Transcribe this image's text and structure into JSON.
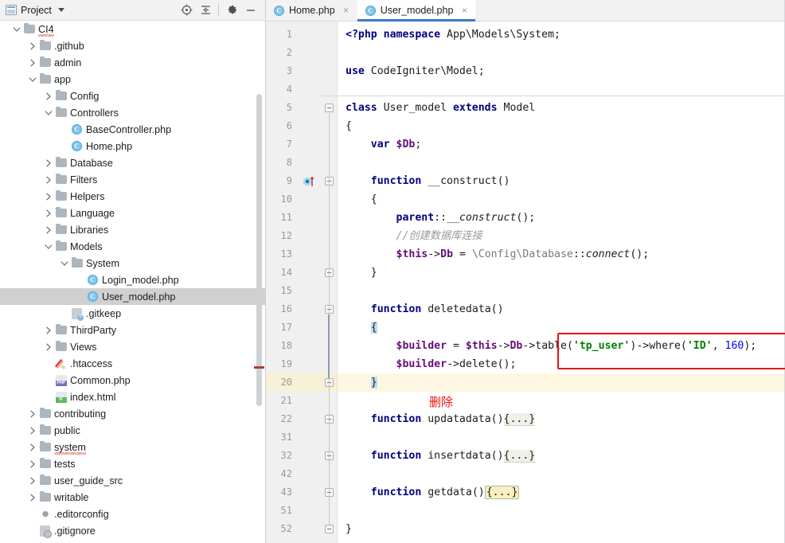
{
  "project_panel": {
    "title": "Project",
    "icon": "project-icon",
    "dropdown_caret": "chevron-down-icon",
    "toolbar_buttons": [
      {
        "name": "select-opened-file-icon",
        "label": ""
      },
      {
        "name": "collapse-all-icon",
        "label": ""
      },
      {
        "name": "settings-gear-icon",
        "label": ""
      },
      {
        "name": "hide-panel-minimize-icon",
        "label": ""
      }
    ],
    "tree": [
      {
        "label": "CI4",
        "depth": 0,
        "icon": "folder",
        "state": "expanded",
        "selected": false,
        "squiggle": true
      },
      {
        "label": ".github",
        "depth": 1,
        "icon": "folder",
        "state": "collapsed",
        "selected": false,
        "squiggle": false
      },
      {
        "label": "admin",
        "depth": 1,
        "icon": "folder",
        "state": "collapsed",
        "selected": false,
        "squiggle": false
      },
      {
        "label": "app",
        "depth": 1,
        "icon": "folder",
        "state": "expanded",
        "selected": false,
        "squiggle": false
      },
      {
        "label": "Config",
        "depth": 2,
        "icon": "folder",
        "state": "collapsed",
        "selected": false,
        "squiggle": false
      },
      {
        "label": "Controllers",
        "depth": 2,
        "icon": "folder",
        "state": "expanded",
        "selected": false,
        "squiggle": false
      },
      {
        "label": "BaseController.php",
        "depth": 3,
        "icon": "class",
        "state": "leaf",
        "selected": false,
        "squiggle": false
      },
      {
        "label": "Home.php",
        "depth": 3,
        "icon": "class",
        "state": "leaf",
        "selected": false,
        "squiggle": false
      },
      {
        "label": "Database",
        "depth": 2,
        "icon": "folder",
        "state": "collapsed",
        "selected": false,
        "squiggle": false
      },
      {
        "label": "Filters",
        "depth": 2,
        "icon": "folder",
        "state": "collapsed",
        "selected": false,
        "squiggle": false
      },
      {
        "label": "Helpers",
        "depth": 2,
        "icon": "folder",
        "state": "collapsed",
        "selected": false,
        "squiggle": false
      },
      {
        "label": "Language",
        "depth": 2,
        "icon": "folder",
        "state": "collapsed",
        "selected": false,
        "squiggle": false
      },
      {
        "label": "Libraries",
        "depth": 2,
        "icon": "folder",
        "state": "collapsed",
        "selected": false,
        "squiggle": false
      },
      {
        "label": "Models",
        "depth": 2,
        "icon": "folder",
        "state": "expanded",
        "selected": false,
        "squiggle": false
      },
      {
        "label": "System",
        "depth": 3,
        "icon": "folder",
        "state": "expanded",
        "selected": false,
        "squiggle": false
      },
      {
        "label": "Login_model.php",
        "depth": 4,
        "icon": "class",
        "state": "leaf",
        "selected": false,
        "squiggle": false
      },
      {
        "label": "User_model.php",
        "depth": 4,
        "icon": "class",
        "state": "leaf",
        "selected": true,
        "squiggle": false
      },
      {
        "label": ".gitkeep",
        "depth": 3,
        "icon": "git",
        "state": "leaf",
        "selected": false,
        "squiggle": false
      },
      {
        "label": "ThirdParty",
        "depth": 2,
        "icon": "folder",
        "state": "collapsed",
        "selected": false,
        "squiggle": false
      },
      {
        "label": "Views",
        "depth": 2,
        "icon": "folder",
        "state": "collapsed",
        "selected": false,
        "squiggle": false
      },
      {
        "label": ".htaccess",
        "depth": 2,
        "icon": "pencil",
        "state": "leaf",
        "selected": false,
        "squiggle": false
      },
      {
        "label": "Common.php",
        "depth": 2,
        "icon": "php",
        "state": "leaf",
        "selected": false,
        "squiggle": false
      },
      {
        "label": "index.html",
        "depth": 2,
        "icon": "html",
        "state": "leaf",
        "selected": false,
        "squiggle": false
      },
      {
        "label": "contributing",
        "depth": 1,
        "icon": "folder",
        "state": "collapsed",
        "selected": false,
        "squiggle": false
      },
      {
        "label": "public",
        "depth": 1,
        "icon": "folder",
        "state": "collapsed",
        "selected": false,
        "squiggle": false
      },
      {
        "label": "system",
        "depth": 1,
        "icon": "folder",
        "state": "collapsed",
        "selected": false,
        "squiggle": true
      },
      {
        "label": "tests",
        "depth": 1,
        "icon": "folder",
        "state": "collapsed",
        "selected": false,
        "squiggle": false
      },
      {
        "label": "user_guide_src",
        "depth": 1,
        "icon": "folder",
        "state": "collapsed",
        "selected": false,
        "squiggle": false
      },
      {
        "label": "writable",
        "depth": 1,
        "icon": "folder",
        "state": "collapsed",
        "selected": false,
        "squiggle": false
      },
      {
        "label": ".editorconfig",
        "depth": 1,
        "icon": "gear",
        "state": "leaf",
        "selected": false,
        "squiggle": false
      },
      {
        "label": ".gitignore",
        "depth": 1,
        "icon": "gitign",
        "state": "leaf",
        "selected": false,
        "squiggle": false
      }
    ]
  },
  "editor": {
    "tabs": [
      {
        "label": "Home.php",
        "icon": "php-class-icon",
        "active": false,
        "close": "×"
      },
      {
        "label": "User_model.php",
        "icon": "php-class-icon",
        "active": true,
        "close": "×"
      }
    ],
    "line_numbers": [
      "1",
      "2",
      "3",
      "4",
      "5",
      "6",
      "7",
      "8",
      "9",
      "10",
      "11",
      "12",
      "13",
      "14",
      "15",
      "16",
      "17",
      "18",
      "19",
      "20",
      "21",
      "22",
      "31",
      "32",
      "42",
      "43",
      "51",
      "52"
    ],
    "current_line": "20",
    "lines": [
      {
        "n": "1",
        "text": "<?php namespace App\\Models\\System;"
      },
      {
        "n": "2",
        "text": ""
      },
      {
        "n": "3",
        "text": "use CodeIgniter\\Model;"
      },
      {
        "n": "4",
        "text": ""
      },
      {
        "n": "5",
        "text": "class User_model extends Model"
      },
      {
        "n": "6",
        "text": "{"
      },
      {
        "n": "7",
        "text": "    var $Db;"
      },
      {
        "n": "8",
        "text": ""
      },
      {
        "n": "9",
        "text": "    function __construct()"
      },
      {
        "n": "10",
        "text": "    {"
      },
      {
        "n": "11",
        "text": "        parent::__construct();"
      },
      {
        "n": "12",
        "text": "        //创建数据库连接"
      },
      {
        "n": "13",
        "text": "        $this->Db = \\Config\\Database::connect();"
      },
      {
        "n": "14",
        "text": "    }"
      },
      {
        "n": "15",
        "text": ""
      },
      {
        "n": "16",
        "text": "    function deletedata()"
      },
      {
        "n": "17",
        "text": "    {"
      },
      {
        "n": "18",
        "text": "        $builder = $this->Db->table('tp_user')->where('ID', 160);"
      },
      {
        "n": "19",
        "text": "        $builder->delete();"
      },
      {
        "n": "20",
        "text": "    }"
      },
      {
        "n": "21",
        "text": ""
      },
      {
        "n": "22",
        "text": "    function updatadata(){...}"
      },
      {
        "n": "31",
        "text": ""
      },
      {
        "n": "32",
        "text": "    function insertdata(){...}"
      },
      {
        "n": "42",
        "text": ""
      },
      {
        "n": "43",
        "text": "    function getdata(){...}"
      },
      {
        "n": "51",
        "text": ""
      },
      {
        "n": "52",
        "text": "}"
      }
    ]
  },
  "annotation": {
    "label": "删除",
    "color": "#e8120f",
    "box_color": "#e8120f"
  },
  "colors": {
    "keyword": "#000080",
    "variable": "#660e7a",
    "string": "#008000",
    "number": "#0000ff",
    "comment": "#9a9a9a",
    "tab_underline": "#3b79c6",
    "selection": "#d0d0d0",
    "current_line": "#fdf7e2"
  }
}
